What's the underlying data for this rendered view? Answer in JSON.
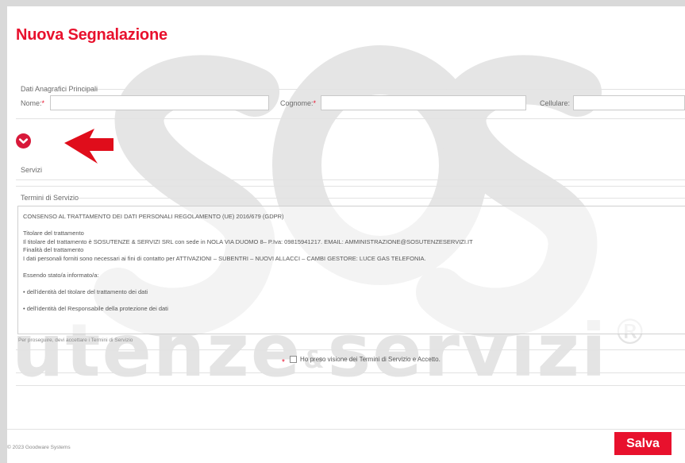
{
  "page": {
    "title": "Nuova Segnalazione"
  },
  "watermark": {
    "text_main": "utenze",
    "text_amp": "&",
    "text_second": "servizi",
    "text_reg": "®"
  },
  "anagrafica": {
    "legend": "Dati Anagrafici Principali",
    "nome_label": "Nome:",
    "cognome_label": "Cognome:",
    "cellulare_label": "Cellulare:",
    "required_mark": "*",
    "nome_value": "",
    "cognome_value": "",
    "cellulare_value": ""
  },
  "servizi": {
    "legend": "Servizi"
  },
  "termini": {
    "legend": "Termini di Servizio",
    "lines": [
      "CONSENSO AL TRATTAMENTO DEI DATI PERSONALI REGOLAMENTO (UE) 2016/679 (GDPR)",
      "",
      "Titolare del trattamento",
      "Il titolare del trattamento è SOSUTENZE & SERVIZI SRL con sede in NOLA VIA DUOMO 8– P.Iva: 09815941217. EMAIL: AMMINISTRAZIONE@SOSUTENZESERVIZI.IT",
      "Finalità del trattamento",
      "I dati personali forniti sono necessari ai fini di contatto per ATTIVAZIONI – SUBENTRI – NUOVI ALLACCI – CAMBI GESTORE: LUCE GAS TELEFONIA.",
      "",
      "Essendo stato/a informato/a:",
      "",
      "• dell'identità del titolare del trattamento dei dati",
      "",
      "• dell'identità del Responsabile della protezione dei dati"
    ],
    "note": "Per proseguire, devi accettare i Termini di Servizio",
    "accept_star": "*",
    "accept_label": "Ho preso visione dei Termini di Servizio e Accetto.",
    "accepted": false
  },
  "footer": {
    "copyright": "© 2023 Goodware Systems",
    "save_label": "Salva"
  },
  "colors": {
    "accent": "#e8112d",
    "toggle": "#d8193a",
    "watermark": "#e4e4e4"
  },
  "icons": {
    "toggle": "chevron-down-icon",
    "arrow": "arrow-left-icon"
  }
}
